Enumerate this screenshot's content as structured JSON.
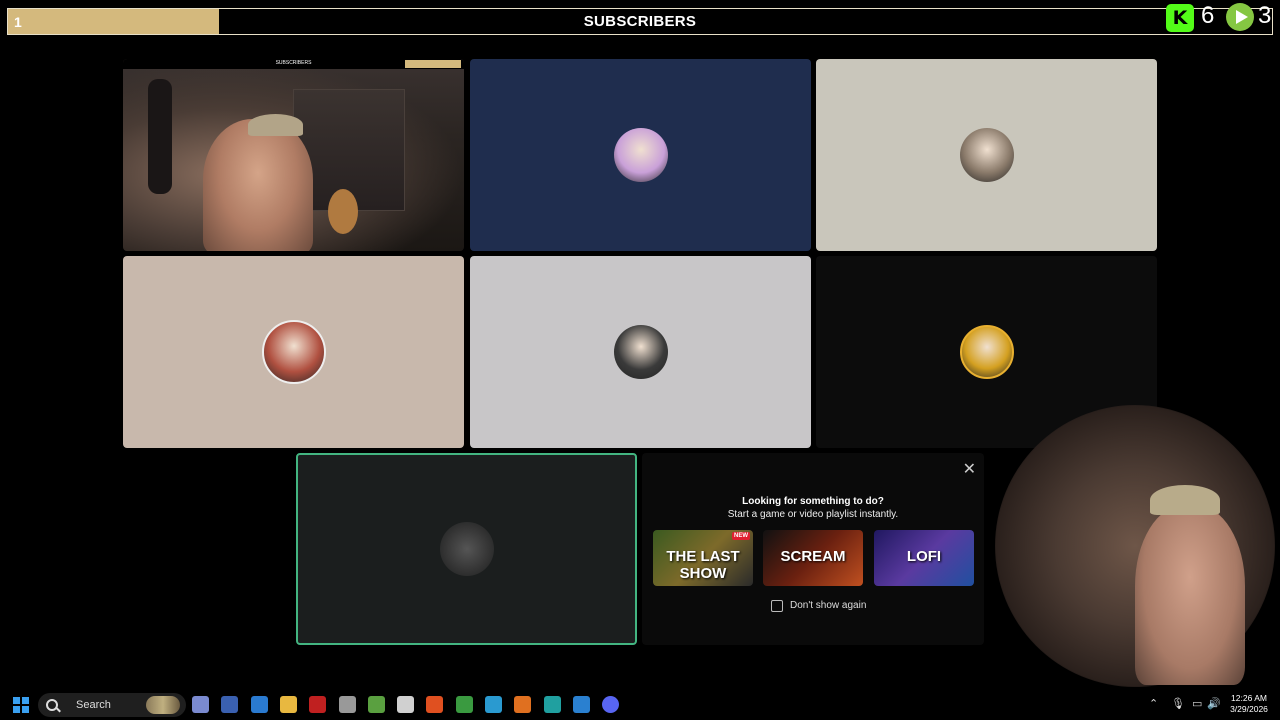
{
  "overlay": {
    "counter": "1",
    "title": "SUBSCRIBERS",
    "progress_fraction": 0.167,
    "kick_count": "6",
    "rumble_count": "3",
    "accent": "#d4b97d"
  },
  "tiles": [
    {
      "kind": "camera",
      "bg": "#2b2522",
      "mini_title": "SUBSCRIBERS"
    },
    {
      "kind": "avatar",
      "bg": "#1f2d4e",
      "avatar_color": "#c9a0d8"
    },
    {
      "kind": "avatar",
      "bg": "#c9c6bb",
      "avatar_color": "#8a7a6a"
    },
    {
      "kind": "avatar",
      "bg": "#c8b8ac",
      "avatar_color": "#b05040"
    },
    {
      "kind": "avatar",
      "bg": "#c8c6c8",
      "avatar_color": "#3a3a3a"
    },
    {
      "kind": "avatar",
      "bg": "#0c0c0c",
      "avatar_color": "#d4a020"
    }
  ],
  "activity": {
    "question": "Looking for something to do?",
    "subtitle": "Start a game or video playlist instantly.",
    "cards": [
      {
        "label": "THE LAST SHOW",
        "badge": "NEW"
      },
      {
        "label": "SCREAM",
        "badge": ""
      },
      {
        "label": "LOFI",
        "badge": ""
      }
    ],
    "checkbox_label": "Don't show again",
    "close_icon": "close-icon"
  },
  "taskbar": {
    "search_label": "Search",
    "time": "12:26 AM",
    "date": "3/29/2026",
    "app_icons": [
      {
        "name": "copilot-icon",
        "color": "#7a8ad0"
      },
      {
        "name": "phone-link-icon",
        "color": "#3a60b0"
      },
      {
        "name": "r-icon",
        "color": "#2a7ad0"
      },
      {
        "name": "file-explorer-icon",
        "color": "#e8b840"
      },
      {
        "name": "watch-app-icon",
        "color": "#c02020"
      },
      {
        "name": "refresh-app-icon",
        "color": "#999999"
      },
      {
        "name": "shield-app-icon",
        "color": "#5aa040"
      },
      {
        "name": "obs-icon",
        "color": "#d0d0d0"
      },
      {
        "name": "brave-icon",
        "color": "#e05020"
      },
      {
        "name": "chrome-icon",
        "color": "#3a9a40"
      },
      {
        "name": "edge-icon",
        "color": "#2a9ad0"
      },
      {
        "name": "firefox-icon",
        "color": "#e07020"
      },
      {
        "name": "arduino-icon",
        "color": "#20a0a0"
      },
      {
        "name": "vscode-icon",
        "color": "#2a80d0"
      },
      {
        "name": "discord-icon",
        "color": "#5865f2"
      }
    ]
  }
}
